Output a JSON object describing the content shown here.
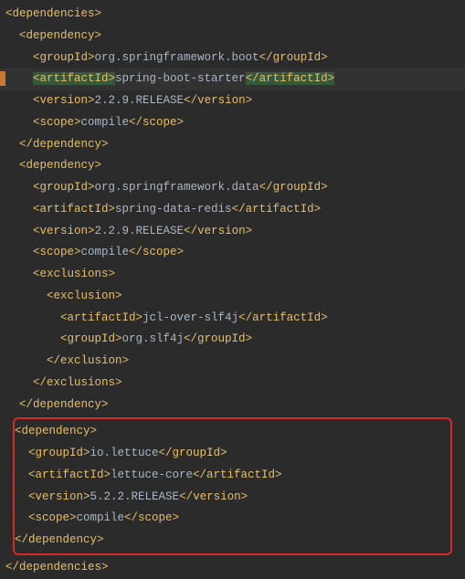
{
  "root": {
    "open": "<dependencies>",
    "close": "</dependencies>"
  },
  "dep_open": "<dependency>",
  "dep_close": "</dependency>",
  "groupId_open": "<groupId>",
  "groupId_close": "</groupId>",
  "artifactId_open": "<artifactId>",
  "artifactId_close": "</artifactId>",
  "version_open": "<version>",
  "version_close": "</version>",
  "scope_open": "<scope>",
  "scope_close": "</scope>",
  "exclusions_open": "<exclusions>",
  "exclusions_close": "</exclusions>",
  "exclusion_open": "<exclusion>",
  "exclusion_close": "</exclusion>",
  "deps": [
    {
      "groupId": "org.springframework.boot",
      "artifactId": "spring-boot-starter",
      "version": "2.2.9.RELEASE",
      "scope": "compile"
    },
    {
      "groupId": "org.springframework.data",
      "artifactId": "spring-data-redis",
      "version": "2.2.9.RELEASE",
      "scope": "compile",
      "exclusion": {
        "artifactId": "jcl-over-slf4j",
        "groupId": "org.slf4j"
      }
    },
    {
      "groupId": "io.lettuce",
      "artifactId": "lettuce-core",
      "version": "5.2.2.RELEASE",
      "scope": "compile"
    }
  ]
}
